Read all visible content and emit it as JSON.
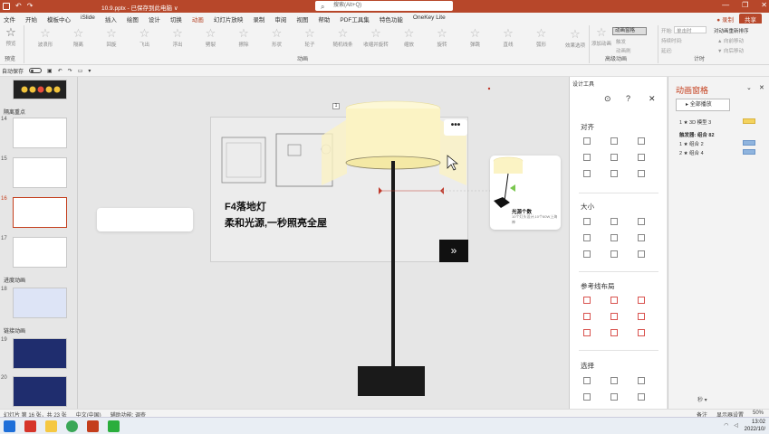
{
  "titlebar": {
    "filename": "10.9.pptx - 已保存到此电脑 ∨",
    "search_placeholder": "搜索(Alt+Q)",
    "minimize": "—",
    "restore": "❐",
    "close": "✕"
  },
  "menu": {
    "tabs": [
      "文件",
      "开始",
      "模板中心",
      "iSlide",
      "插入",
      "绘图",
      "设计",
      "切换",
      "动画",
      "幻灯片放映",
      "录制",
      "审阅",
      "视图",
      "帮助",
      "PDF工具集",
      "特色功能",
      "OneKey Lite"
    ],
    "active_tab": "动画",
    "record_label": "录制",
    "share_label": "共享"
  },
  "ribbon": {
    "preview_label": "预览",
    "preview_group": "预览",
    "effects": [
      "波浪形",
      "隔离",
      "回旋",
      "飞出",
      "浮出",
      "劈裂",
      "擦除",
      "形状",
      "轮子",
      "随机线条",
      "收缩并旋转",
      "缩放",
      "旋转",
      "弹跳",
      "直线",
      "弧形"
    ],
    "effect_options": "效果选项",
    "animation_group": "动画",
    "add_animation": "添加动画",
    "animation_pane": "动画窗格",
    "trigger": "触发",
    "animation_painter": "动画刷",
    "advanced_group": "高级动画",
    "start_label": "开始:",
    "start_value": "单击时",
    "duration_label": "持续时间:",
    "delay_label": "延迟:",
    "reorder": "对动画重新排序",
    "move_earlier": "▲ 向前移动",
    "move_later": "▼ 向后移动",
    "timing_group": "计时"
  },
  "qat": {
    "autosave": "自动保存",
    "autosave_state": "关"
  },
  "thumbs": {
    "items": [
      {
        "num": "14"
      },
      {
        "num": "15"
      },
      {
        "num": "16"
      },
      {
        "num": "17"
      },
      {
        "num": "18"
      },
      {
        "num": "19"
      },
      {
        "num": "20"
      }
    ],
    "sections": [
      "隔离重点",
      "进度动画",
      "链接动画"
    ]
  },
  "slide": {
    "title": "F4落地灯",
    "subtitle": "柔和光源,一秒照亮全屋",
    "next_glyph": "»",
    "more_glyph": "•••",
    "card_title": "光源个数",
    "card_sub": "10个灯头设计,10个60W上海神",
    "badge": "1"
  },
  "design_pane": {
    "header": "设计工具",
    "sections": [
      "对齐",
      "大小",
      "参考线布局",
      "选择"
    ]
  },
  "anim_pane": {
    "title": "动画窗格",
    "play_all": "全部播放",
    "rows": [
      {
        "label": "1  ★ 3D 模型 3"
      },
      {
        "label": "触发器: 组合 82"
      },
      {
        "label": "1  ★ 组合 2"
      },
      {
        "label": "2  ★ 组合 4"
      }
    ],
    "seconds_label": "秒 ▾"
  },
  "status": {
    "slide_info": "幻灯片 第 16 张，共 23 张",
    "language": "中文(中国)",
    "accessibility": "辅助功能: 调查",
    "notes": "备注",
    "display_settings": "显示器设置",
    "zoom": "50%"
  },
  "taskbar": {
    "time": "13:02",
    "date": "2022/10/"
  },
  "colors": {
    "accent": "#b7472a",
    "anim_bar": "#8fb4de"
  }
}
